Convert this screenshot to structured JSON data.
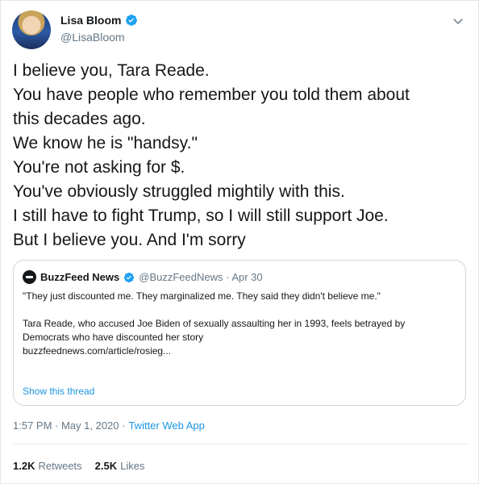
{
  "author": {
    "display_name": "Lisa Bloom",
    "handle": "@LisaBloom"
  },
  "tweet": {
    "lines": [
      "I believe you, Tara Reade.",
      "You have people who remember you told them about",
      "this decades ago.",
      "We know he is \"handsy.\"",
      "You're not asking for $.",
      "You've obviously struggled mightily with this.",
      "I still have to fight Trump, so I will still support Joe.",
      "But I believe you. And I'm sorry"
    ]
  },
  "quoted": {
    "name": "BuzzFeed News",
    "handle_date": "@BuzzFeedNews · Apr 30",
    "quote_line": "\"They just discounted me. They marginalized me. They said they didn't believe me.\"",
    "summary": "Tara Reade, who accused Joe Biden of sexually assaulting her in 1993, feels betrayed by Democrats who have discounted her story",
    "url": "buzzfeednews.com/article/rosieg...",
    "thread_link": "Show this thread"
  },
  "meta": {
    "time": "1:57 PM · May 1, 2020 ·",
    "app": "Twitter Web App"
  },
  "stats": {
    "retweets_count": "1.2K",
    "retweets_label": "Retweets",
    "likes_count": "2.5K",
    "likes_label": "Likes"
  },
  "colors": {
    "link": "#1b95e0",
    "verified": "#1da1f2",
    "muted": "#657786"
  }
}
